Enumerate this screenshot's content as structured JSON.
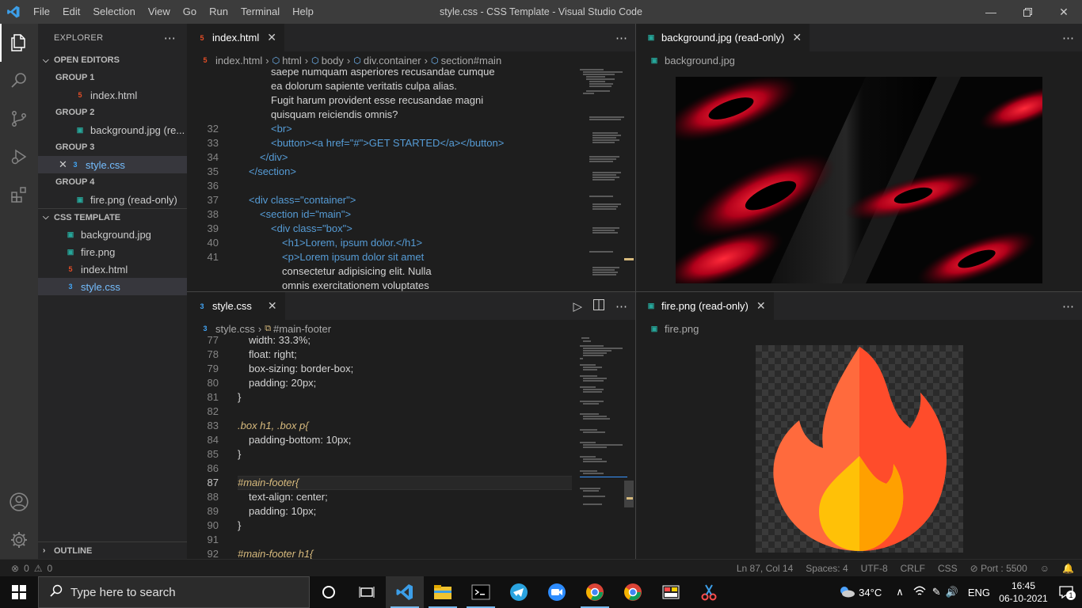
{
  "app": {
    "title": "style.css - CSS Template - Visual Studio Code",
    "menu": [
      "File",
      "Edit",
      "Selection",
      "View",
      "Go",
      "Run",
      "Terminal",
      "Help"
    ]
  },
  "sidebar": {
    "header": "EXPLORER",
    "open_editors_label": "OPEN EDITORS",
    "groups": [
      {
        "label": "GROUP 1",
        "file": "index.html"
      },
      {
        "label": "GROUP 2",
        "file": "background.jpg (re..."
      },
      {
        "label": "GROUP 3",
        "file": "style.css"
      },
      {
        "label": "GROUP 4",
        "file": "fire.png (read-only)"
      }
    ],
    "project_label": "CSS TEMPLATE",
    "files": [
      "background.jpg",
      "fire.png",
      "index.html",
      "style.css"
    ],
    "outline_label": "OUTLINE"
  },
  "editor_top_left": {
    "tab": "index.html",
    "breadcrumb": [
      "index.html",
      "html",
      "body",
      "div.container",
      "section#main"
    ],
    "lines": [
      {
        "n": "",
        "text": "saepe numquam asperiores recusandae cumque"
      },
      {
        "n": "",
        "text": "ea dolorum sapiente veritatis culpa alias."
      },
      {
        "n": "",
        "text": "Fugit harum provident esse recusandae magni"
      },
      {
        "n": "",
        "text": "quisquam reiciendis omnis?"
      },
      {
        "n": "32",
        "text": "<br>"
      },
      {
        "n": "33",
        "text": "<button><a href=\"#\">GET STARTED</a></button>"
      },
      {
        "n": "34",
        "text": "</div>"
      },
      {
        "n": "35",
        "text": "</section>"
      },
      {
        "n": "36",
        "text": ""
      },
      {
        "n": "37",
        "text": "<div class=\"container\">"
      },
      {
        "n": "38",
        "text": "<section id=\"main\">"
      },
      {
        "n": "39",
        "text": "<div class=\"box\">"
      },
      {
        "n": "40",
        "text": "<h1>Lorem, ipsum dolor.</h1>"
      },
      {
        "n": "41",
        "text": "<p>Lorem ipsum dolor sit amet"
      },
      {
        "n": "",
        "text": "consectetur adipisicing elit. Nulla"
      },
      {
        "n": "",
        "text": "omnis exercitationem voluptates"
      }
    ]
  },
  "editor_top_right": {
    "tab": "background.jpg (read-only)",
    "breadcrumb": "background.jpg"
  },
  "editor_bottom_left": {
    "tab": "style.css",
    "breadcrumb": [
      "style.css",
      "#main-footer"
    ],
    "lines": [
      {
        "n": "77",
        "text": "width: 33.3%;"
      },
      {
        "n": "78",
        "text": "float: right;"
      },
      {
        "n": "79",
        "text": "box-sizing: border-box;"
      },
      {
        "n": "80",
        "text": "padding: 20px;"
      },
      {
        "n": "81",
        "text": "}"
      },
      {
        "n": "82",
        "text": ""
      },
      {
        "n": "83",
        "text": ".box h1, .box p{"
      },
      {
        "n": "84",
        "text": "padding-bottom: 10px;"
      },
      {
        "n": "85",
        "text": "}"
      },
      {
        "n": "86",
        "text": ""
      },
      {
        "n": "87",
        "text": "#main-footer{"
      },
      {
        "n": "88",
        "text": "text-align: center;"
      },
      {
        "n": "89",
        "text": "padding: 10px;"
      },
      {
        "n": "90",
        "text": "}"
      },
      {
        "n": "91",
        "text": ""
      },
      {
        "n": "92",
        "text": "#main-footer h1{"
      }
    ]
  },
  "editor_bottom_right": {
    "tab": "fire.png (read-only)",
    "breadcrumb": "fire.png"
  },
  "status": {
    "errors": "0",
    "warnings": "0",
    "position": "Ln 87, Col 14",
    "spaces": "Spaces: 4",
    "encoding": "UTF-8",
    "eol": "CRLF",
    "language": "CSS",
    "port": "Port : 5500"
  },
  "taskbar": {
    "search_placeholder": "Type here to search",
    "weather": "34°C",
    "language": "ENG",
    "time": "16:45",
    "date": "06-10-2021",
    "notification_count": "1"
  },
  "colors": {
    "accent": "#007acc",
    "html_icon": "#e44d26",
    "css_icon": "#42a5f5",
    "image_icon": "#26a69a"
  }
}
